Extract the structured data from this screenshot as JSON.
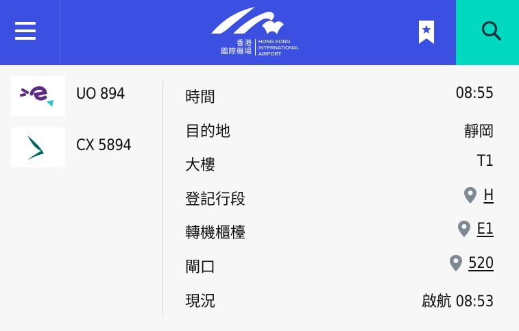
{
  "header": {
    "logo": {
      "zh_line1": "香港",
      "zh_line2": "國際機場",
      "en_line1": "HONG KONG",
      "en_line2": "INTERNATIONAL",
      "en_line3": "AIRPORT"
    },
    "icons": [
      "menu-icon",
      "bookmark-star-icon",
      "search-icon"
    ],
    "colors": {
      "bar": "#3b4fe0",
      "search_bg": "#00d8c0"
    }
  },
  "airlines": [
    {
      "logo": "hk-express-logo",
      "flight_no": "UO 894"
    },
    {
      "logo": "cathay-pacific-logo",
      "flight_no": "CX 5894"
    }
  ],
  "details": {
    "time": {
      "label": "時間",
      "value": "08:55"
    },
    "destination": {
      "label": "目的地",
      "value": "靜岡"
    },
    "terminal": {
      "label": "大樓",
      "value": "T1"
    },
    "aisle": {
      "label": "登記行段",
      "value": "H"
    },
    "counter": {
      "label": "轉機櫃檯",
      "value": "E1"
    },
    "gate": {
      "label": "閘口",
      "value": "520"
    },
    "status": {
      "label": "現況",
      "value": "啟航 08:53"
    }
  }
}
